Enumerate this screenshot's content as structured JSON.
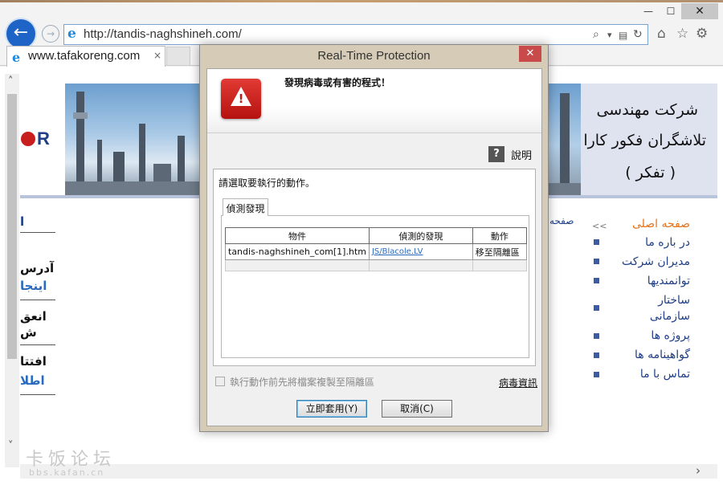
{
  "browser": {
    "window_controls": {
      "minimize": "—",
      "maximize": "☐",
      "close": "✕"
    },
    "back_icon": "arrow-left-icon",
    "forward_icon": "arrow-right-icon",
    "url": "http://tandis-naghshineh.com/",
    "tab": {
      "title": "www.tafakoreng.com",
      "close": "×"
    },
    "address_icons": {
      "search": "⌕",
      "dropdown": "▾",
      "reload": "↻"
    },
    "toolbar_icons": {
      "home": "⌂",
      "favorites": "☆",
      "settings": "⚙"
    }
  },
  "website": {
    "logo": "R",
    "company_name_lines": [
      "شرکت مهندسی",
      "تلاشگران فکور کارا",
      "( تفکر )"
    ],
    "left_column": {
      "heading": "ا",
      "items": [
        {
          "text": "آدرس",
          "link": "اینجا"
        },
        {
          "text": "انعق",
          "link": "ش"
        },
        {
          "text": "افتتا",
          "link": "اطلا"
        }
      ]
    },
    "crumb": "صفحه",
    "menu": {
      "home_marker": "<<",
      "items": [
        "صفحه اصلی",
        "در باره ما",
        "مدیران شرکت",
        "توانمندیها",
        "ساختار",
        "سازمانی",
        "پروژه ها",
        "گواهینامه ها",
        "تماس با ما"
      ]
    },
    "watermark": "卡饭论坛",
    "watermark_url": "bbs.kafan.cn"
  },
  "dialog": {
    "title": "Real-Time Protection",
    "close": "✕",
    "heading": "發現病毒或有害的程式！",
    "warning_symbol": "!",
    "help_symbol": "?",
    "help_label": "說明",
    "prompt": "請選取要執行的動作。",
    "tab_label": "偵測發現",
    "table": {
      "headers": [
        "物件",
        "偵測的發現",
        "動作"
      ],
      "rows": [
        [
          "tandis-naghshineh_com[1].htm",
          "JS/Blacole.LV",
          "移至隔離區"
        ]
      ]
    },
    "copy_checkbox_label": "執行動作前先將檔案複製至隔離區",
    "virus_info_link": "病毒資訊",
    "apply_button": "立即套用(Y)",
    "cancel_button": "取消(C)"
  }
}
